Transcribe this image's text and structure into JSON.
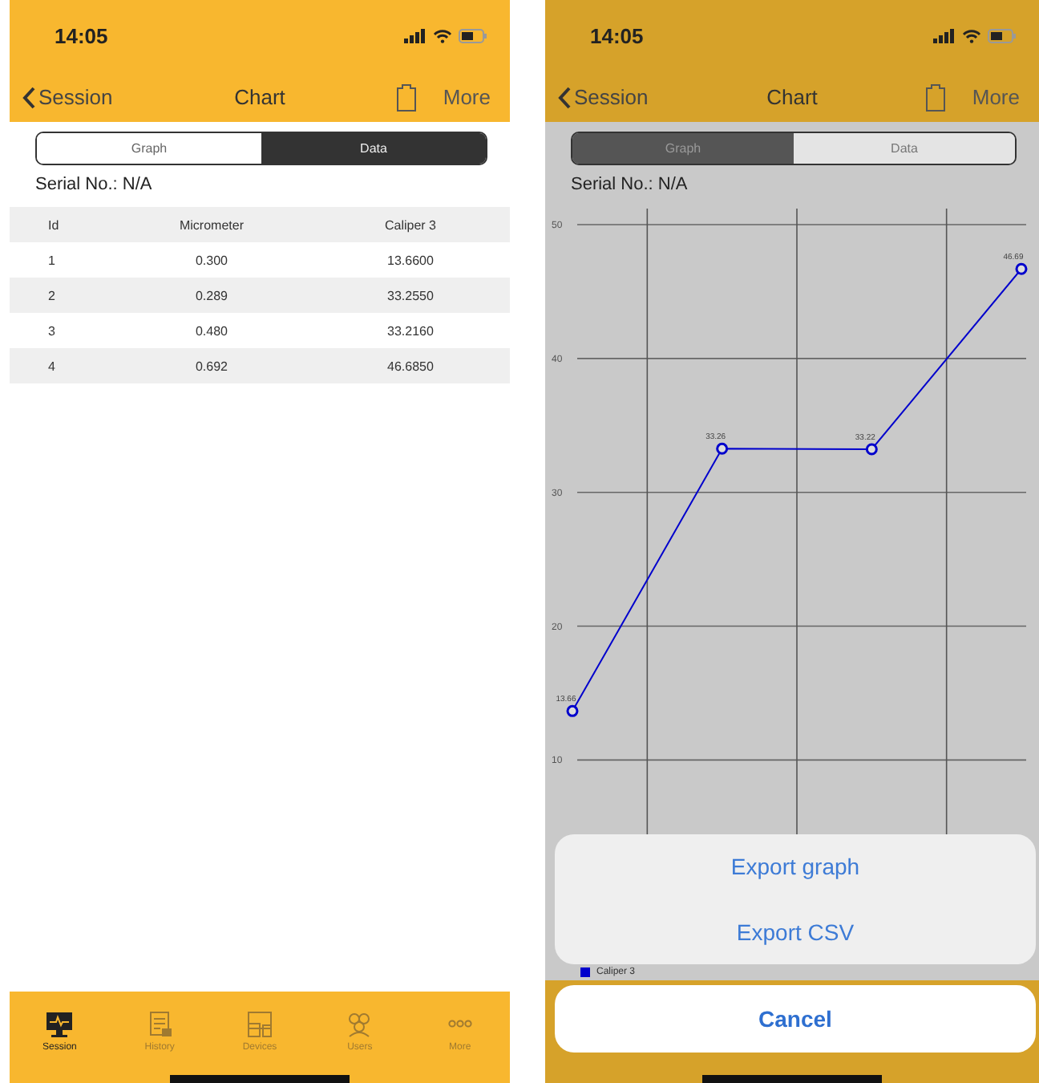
{
  "left_screen": {
    "status_bar": {
      "time": "14:05"
    },
    "nav": {
      "back": "Session",
      "title": "Chart",
      "more": "More"
    },
    "segments": [
      {
        "label": "Graph",
        "selected": false
      },
      {
        "label": "Data",
        "selected": true
      }
    ],
    "serial": "Serial No.: N/A",
    "table": {
      "columns": [
        "Id",
        "Micrometer",
        "Caliper 3"
      ],
      "rows": [
        [
          "1",
          "0.300",
          "13.6600"
        ],
        [
          "2",
          "0.289",
          "33.2550"
        ],
        [
          "3",
          "0.480",
          "33.2160"
        ],
        [
          "4",
          "0.692",
          "46.6850"
        ]
      ]
    },
    "tab_bar": [
      {
        "label": "Session",
        "selected": true
      },
      {
        "label": "History",
        "selected": false
      },
      {
        "label": "Devices",
        "selected": false
      },
      {
        "label": "Users",
        "selected": false
      },
      {
        "label": "More",
        "selected": false
      }
    ]
  },
  "right_screen": {
    "status_bar": {
      "time": "14:05"
    },
    "nav": {
      "back": "Session",
      "title": "Chart",
      "more": "More"
    },
    "segments": [
      {
        "label": "Graph",
        "selected": true
      },
      {
        "label": "Data",
        "selected": false
      }
    ],
    "serial": "Serial No.: N/A",
    "chart_data": {
      "type": "line",
      "grid": true,
      "series": [
        {
          "name": "Caliper 3",
          "color": "#0000cc",
          "marker": "circle",
          "values": [
            13.66,
            33.26,
            33.22,
            46.69
          ]
        }
      ],
      "ylim": [
        -4.9,
        51.2
      ],
      "yticks": [
        10,
        20,
        30,
        40,
        50
      ],
      "data_labels": true,
      "value_labels": [
        "13.66",
        "33.26",
        "33.22",
        "46.69"
      ]
    },
    "action_sheet": {
      "actions": [
        "Export graph",
        "Export CSV"
      ],
      "cancel": "Cancel"
    }
  }
}
